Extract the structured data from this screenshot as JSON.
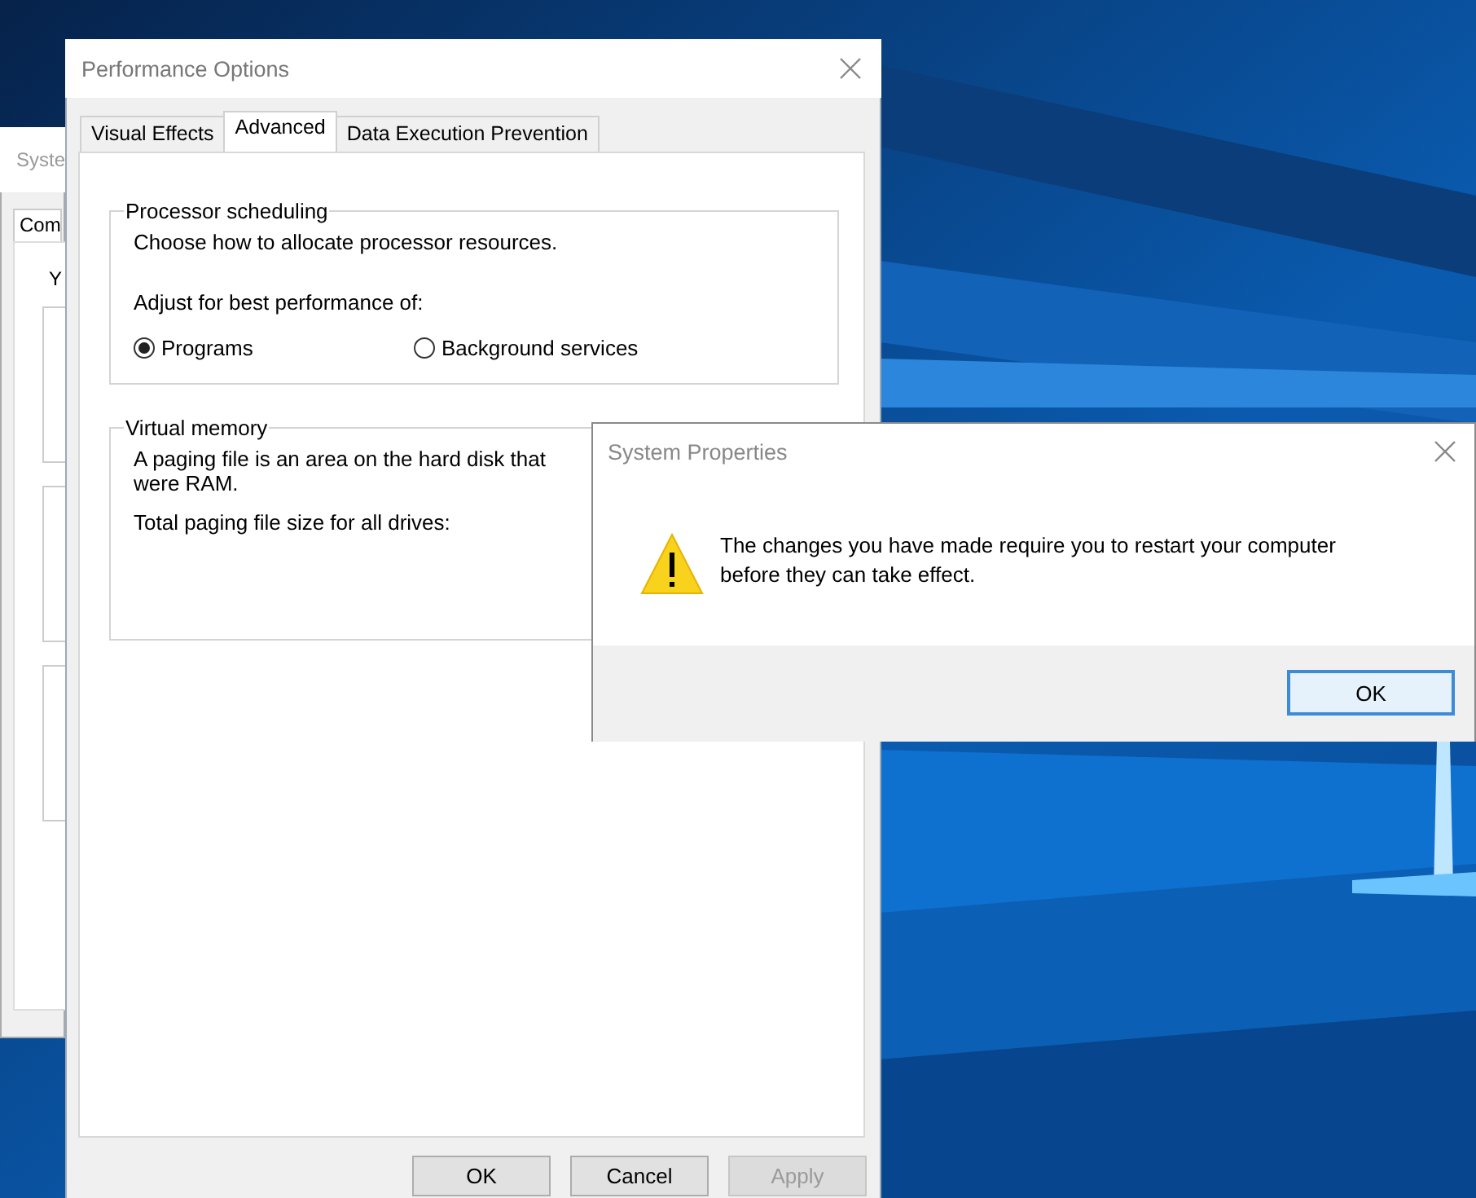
{
  "background_window": {
    "title": "Syste",
    "tabs": [
      {
        "label": "Com",
        "selected": true
      }
    ],
    "intro": "Y"
  },
  "performance_options": {
    "title": "Performance Options",
    "tabs": [
      {
        "label": "Visual Effects",
        "selected": false
      },
      {
        "label": "Advanced",
        "selected": true
      },
      {
        "label": "Data Execution Prevention",
        "selected": false
      }
    ],
    "processor_scheduling": {
      "title": "Processor scheduling",
      "description": "Choose how to allocate processor resources.",
      "prompt": "Adjust for best performance of:",
      "options": [
        {
          "label": "Programs",
          "selected": true
        },
        {
          "label": "Background services",
          "selected": false
        }
      ]
    },
    "virtual_memory": {
      "title": "Virtual memory",
      "lines": [
        "A paging file is an area on the hard disk that",
        "were RAM."
      ],
      "total_label": "Total paging file size for all drives:"
    },
    "buttons": [
      {
        "label": "OK",
        "disabled": false
      },
      {
        "label": "Cancel",
        "disabled": false
      },
      {
        "label": "Apply",
        "disabled": true
      }
    ]
  },
  "message_box": {
    "title": "System Properties",
    "message": "The changes you have made require you to restart your computer before they can take effect.",
    "buttons": [
      {
        "label": "OK",
        "default": true
      }
    ]
  }
}
